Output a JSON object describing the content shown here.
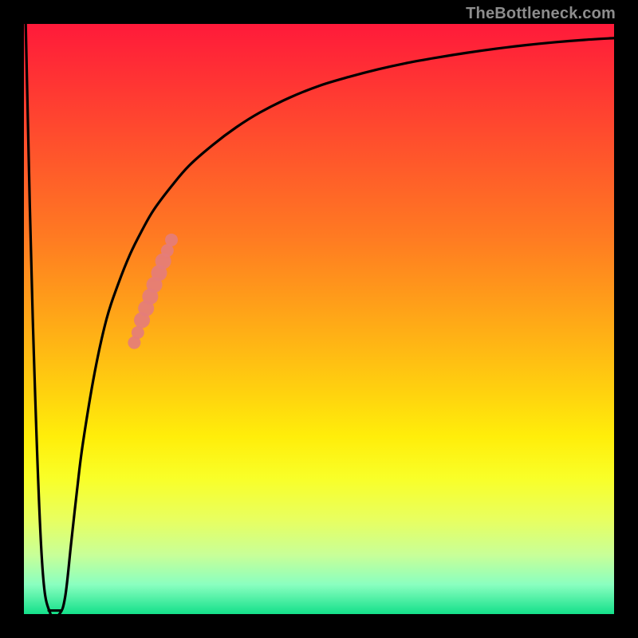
{
  "watermark": "TheBottleneck.com",
  "chart_data": {
    "type": "line",
    "title": "",
    "xlabel": "",
    "ylabel": "",
    "xlim": [
      0,
      100
    ],
    "ylim": [
      0,
      100
    ],
    "grid": false,
    "legend": false,
    "series": [
      {
        "name": "curve",
        "color": "#000000",
        "x": [
          0.3,
          1.5,
          3,
          4.5,
          6,
          7,
          8,
          9,
          10,
          12,
          14,
          16,
          18,
          20,
          22,
          25,
          28,
          32,
          36,
          40,
          45,
          50,
          55,
          60,
          65,
          70,
          75,
          80,
          85,
          90,
          95,
          100
        ],
        "y": [
          100,
          50,
          10,
          0,
          0,
          3,
          12,
          21,
          29,
          41,
          50,
          56,
          61,
          65,
          68.5,
          72.5,
          76,
          79.5,
          82.5,
          85,
          87.5,
          89.5,
          91,
          92.3,
          93.4,
          94.3,
          95.1,
          95.8,
          96.4,
          96.9,
          97.3,
          97.6
        ]
      },
      {
        "name": "valley-floor",
        "color": "#000000",
        "x": [
          4.2,
          6.2
        ],
        "y": [
          0.6,
          0.6
        ]
      }
    ],
    "highlight": {
      "name": "marker-band",
      "color": "#e57d7a",
      "points": [
        {
          "x": 18.7,
          "y": 46.0
        },
        {
          "x": 19.3,
          "y": 47.7
        },
        {
          "x": 20.0,
          "y": 49.8
        },
        {
          "x": 20.7,
          "y": 51.8
        },
        {
          "x": 21.4,
          "y": 53.8
        },
        {
          "x": 22.1,
          "y": 55.8
        },
        {
          "x": 22.9,
          "y": 57.8
        },
        {
          "x": 23.6,
          "y": 59.8
        },
        {
          "x": 24.3,
          "y": 61.6
        },
        {
          "x": 25.0,
          "y": 63.4
        }
      ]
    }
  }
}
